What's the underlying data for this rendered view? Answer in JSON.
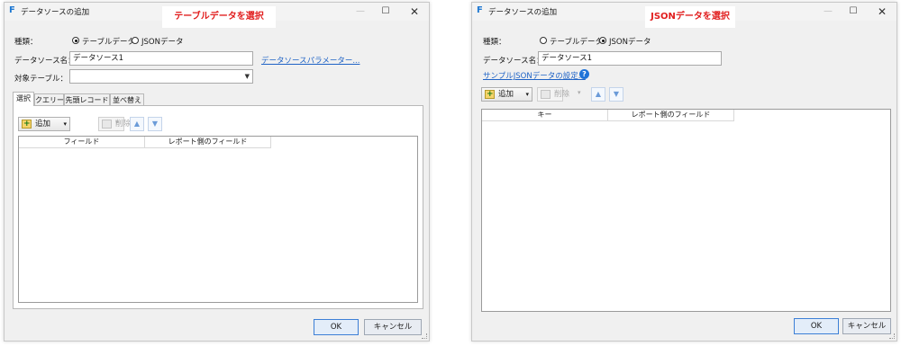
{
  "left": {
    "window_title": "データソースの追加",
    "banner": "テーブルデータを選択",
    "kind_label": "種類：",
    "radio_table": "テーブルデータ",
    "radio_json": "JSONデータ",
    "datasource_name_label": "データソース名：",
    "datasource_name_value": "データソース1",
    "param_link": "データソースパラメーター...",
    "target_table_label": "対象テーブル：",
    "tabs": [
      "選択",
      "クエリー",
      "先頭レコード",
      "並べ替え"
    ],
    "add_label": "追加",
    "delete_label": "削除",
    "grid_columns": [
      "フィールド",
      "レポート側のフィールド"
    ],
    "ok_label": "OK",
    "cancel_label": "キャンセル"
  },
  "right": {
    "window_title": "データソースの追加",
    "banner": "JSONデータを選択",
    "kind_label": "種類：",
    "radio_table": "テーブルデータ",
    "radio_json": "JSONデータ",
    "datasource_name_label": "データソース名：",
    "datasource_name_value": "データソース1",
    "sample_link": "サンプルJSONデータの設定...",
    "add_label": "追加",
    "delete_label": "削除",
    "grid_columns": [
      "キー",
      "レポート側のフィールド"
    ],
    "ok_label": "OK",
    "cancel_label": "キャンセル"
  },
  "icons": {
    "logo": "app-logo-icon",
    "minimize": "minimize-icon",
    "maximize": "maximize-icon",
    "close": "close-icon",
    "add": "add-icon",
    "delete": "delete-icon",
    "move_up": "arrow-up-icon",
    "move_down": "arrow-down-icon",
    "help": "help-icon"
  },
  "colors": {
    "banner_text": "#e11e1e",
    "link": "#1f63c6",
    "help": "#1f73d8"
  }
}
